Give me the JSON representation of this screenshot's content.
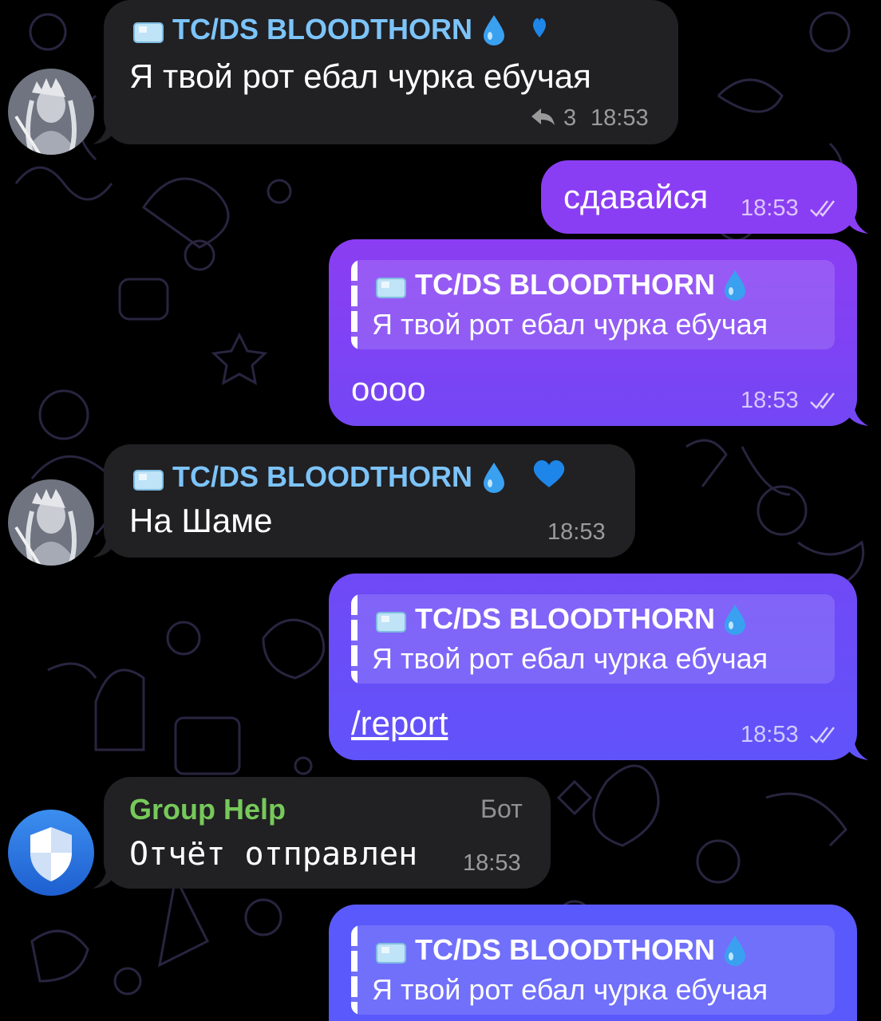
{
  "chat": {
    "messages": [
      {
        "sender": "TC/DS BLOODTHORN",
        "text": "Я твой рот ебал чурка ебучая",
        "replies": "3",
        "time": "18:53"
      },
      {
        "text": "сдавайся",
        "time": "18:53"
      },
      {
        "reply_to": {
          "sender": "TC/DS BLOODTHORN",
          "text": "Я твой рот ебал чурка ебучая"
        },
        "text": "оооо",
        "time": "18:53"
      },
      {
        "sender": "TC/DS BLOODTHORN",
        "text": "На Шаме",
        "time": "18:53"
      },
      {
        "reply_to": {
          "sender": "TC/DS BLOODTHORN",
          "text": "Я твой рот ебал чурка ебучая"
        },
        "text": "/report",
        "time": "18:53"
      },
      {
        "sender": "Group Help",
        "badge": "Бот",
        "text": "Отчёт отправлен",
        "time": "18:53"
      },
      {
        "reply_to": {
          "sender": "TC/DS BLOODTHORN",
          "text": "Я твой рот ебал чурка ебучая"
        }
      }
    ]
  },
  "icons": {
    "reply_arrow": "reply-arrow-icon",
    "read_ticks": "double-check-icon",
    "ice_cube": "ice-cube-emoji",
    "water_drop": "water-drop-emoji",
    "heart": "blue-heart-emoji",
    "shield": "shield-icon"
  },
  "colors": {
    "incoming_bubble": "#212023",
    "outgoing_top": "#8b3df2",
    "outgoing_bottom": "#5b57fb",
    "sender_name": "#7cc4f9",
    "bot_name": "#76c95a"
  }
}
